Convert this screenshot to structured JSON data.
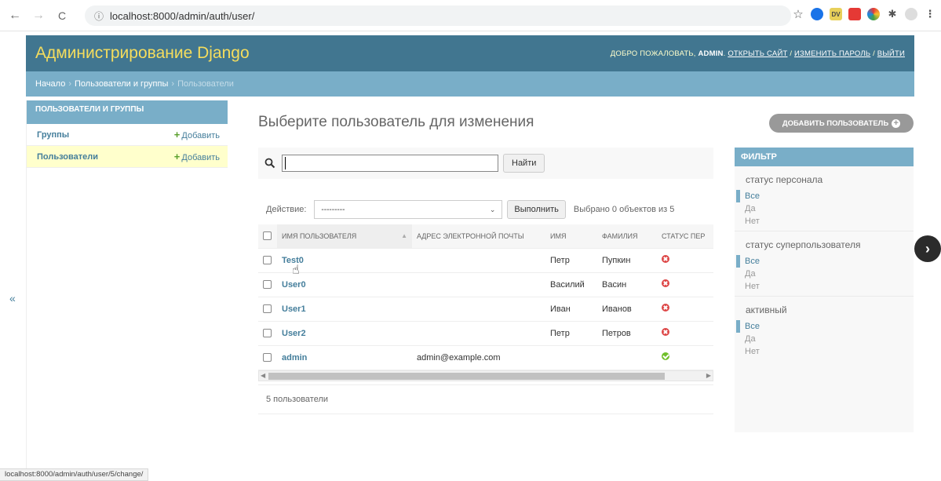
{
  "browser": {
    "url": "localhost:8000/admin/auth/user/",
    "back": "←",
    "forward": "→",
    "reload": "C",
    "status_url": "localhost:8000/admin/auth/user/5/change/"
  },
  "header": {
    "site_name": "Администрирование Django",
    "welcome": "ДОБРО ПОЖАЛОВАТЬ,",
    "username": "ADMIN",
    "view_site": "ОТКРЫТЬ САЙТ",
    "change_password": "ИЗМЕНИТЬ ПАРОЛЬ",
    "logout": "ВЫЙТИ",
    "separator": " / "
  },
  "breadcrumbs": {
    "home": "Начало",
    "app": "Пользователи и группы",
    "current": "Пользователи",
    "separator": "›"
  },
  "sidebar": {
    "caption": "ПОЛЬЗОВАТЕЛИ И ГРУППЫ",
    "items": [
      {
        "label": "Группы",
        "add": "Добавить"
      },
      {
        "label": "Пользователи",
        "add": "Добавить"
      }
    ],
    "collapse": "«"
  },
  "content": {
    "title": "Выберите пользователь для изменения",
    "add_button": "ДОБАВИТЬ ПОЛЬЗОВАТЕЛЬ",
    "search_button": "Найти",
    "action_label": "Действие:",
    "action_selected": "---------",
    "run_button": "Выполнить",
    "selected_count": "Выбрано 0 объектов из 5",
    "columns": [
      "ИМЯ ПОЛЬЗОВАТЕЛЯ",
      "АДРЕС ЭЛЕКТРОННОЙ ПОЧТЫ",
      "ИМЯ",
      "ФАМИЛИЯ",
      "СТАТУС ПЕР"
    ],
    "rows": [
      {
        "username": "Test0",
        "email": "",
        "first_name": "Петр",
        "last_name": "Пупкин",
        "staff": false
      },
      {
        "username": "User0",
        "email": "",
        "first_name": "Василий",
        "last_name": "Васин",
        "staff": false
      },
      {
        "username": "User1",
        "email": "",
        "first_name": "Иван",
        "last_name": "Иванов",
        "staff": false
      },
      {
        "username": "User2",
        "email": "",
        "first_name": "Петр",
        "last_name": "Петров",
        "staff": false
      },
      {
        "username": "admin",
        "email": "admin@example.com",
        "first_name": "",
        "last_name": "",
        "staff": true
      }
    ],
    "paginator": "5 пользователи"
  },
  "filter": {
    "title": "ФИЛЬТР",
    "groups": [
      {
        "title": "статус персонала",
        "options": [
          "Все",
          "Да",
          "Нет"
        ]
      },
      {
        "title": "статус суперпользователя",
        "options": [
          "Все",
          "Да",
          "Нет"
        ]
      },
      {
        "title": "активный",
        "options": [
          "Все",
          "Да",
          "Нет"
        ]
      }
    ]
  },
  "colors": {
    "header_bg": "#417690",
    "breadcrumb_bg": "#79aec8",
    "site_name": "#f5dd5d",
    "link": "#447e9b",
    "current_row": "#ffffcc"
  }
}
